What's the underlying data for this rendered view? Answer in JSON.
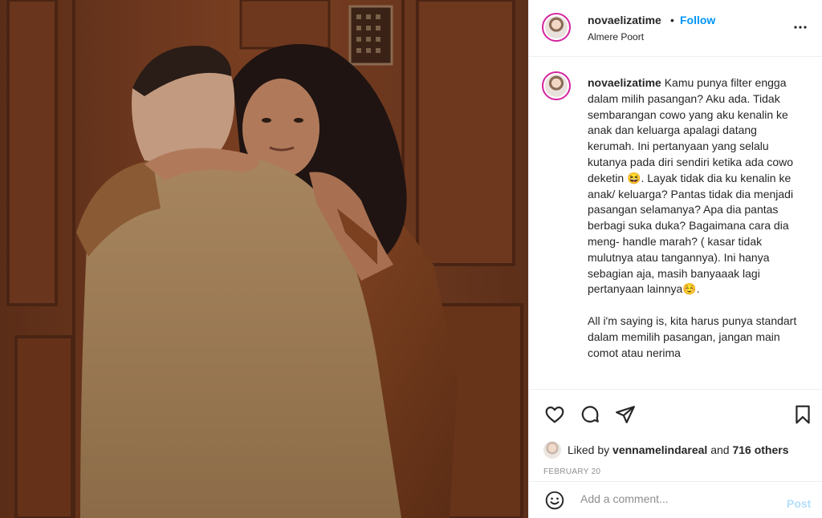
{
  "post": {
    "username": "novaelizatime",
    "separator": "•",
    "follow_label": "Follow",
    "location": "Almere Poort",
    "more_icon": "more-options-icon",
    "image_alt": "Couple embracing in front of a wooden door"
  },
  "caption": {
    "username": "novaelizatime",
    "paragraph1": "Kamu punya filter engga dalam milih pasangan? Aku ada. Tidak sembarangan cowo yang aku kenalin ke anak dan keluarga apalagi datang kerumah. Ini pertanyaan yang selalu kutanya pada diri sendiri ketika ada cowo deketin 😆. Layak tidak dia ku kenalin ke anak/ keluarga? Pantas tidak dia menjadi pasangan selamanya? Apa dia pantas berbagi suka duka? Bagaimana cara dia meng- handle marah? ( kasar tidak mulutnya atau tangannya). Ini hanya sebagian aja, masih banyaaak lagi pertanyaan lainnya☺️.",
    "paragraph2": "All i'm saying is, kita harus punya standart dalam memilih pasangan, jangan main comot atau nerima"
  },
  "actions": {
    "like_icon": "heart-icon",
    "comment_icon": "comment-icon",
    "share_icon": "share-icon",
    "save_icon": "bookmark-icon"
  },
  "likes": {
    "prefix": "Liked by",
    "liker": "vennamelindareal",
    "conj": "and",
    "others": "716 others"
  },
  "date": "FEBRUARY 20",
  "comment": {
    "placeholder": "Add a comment...",
    "post_label": "Post",
    "emoji_icon": "emoji-icon"
  },
  "colors": {
    "accent": "#0095f6",
    "post_disabled": "#b2dffc",
    "text": "#262626",
    "muted": "#8e8e8e"
  }
}
